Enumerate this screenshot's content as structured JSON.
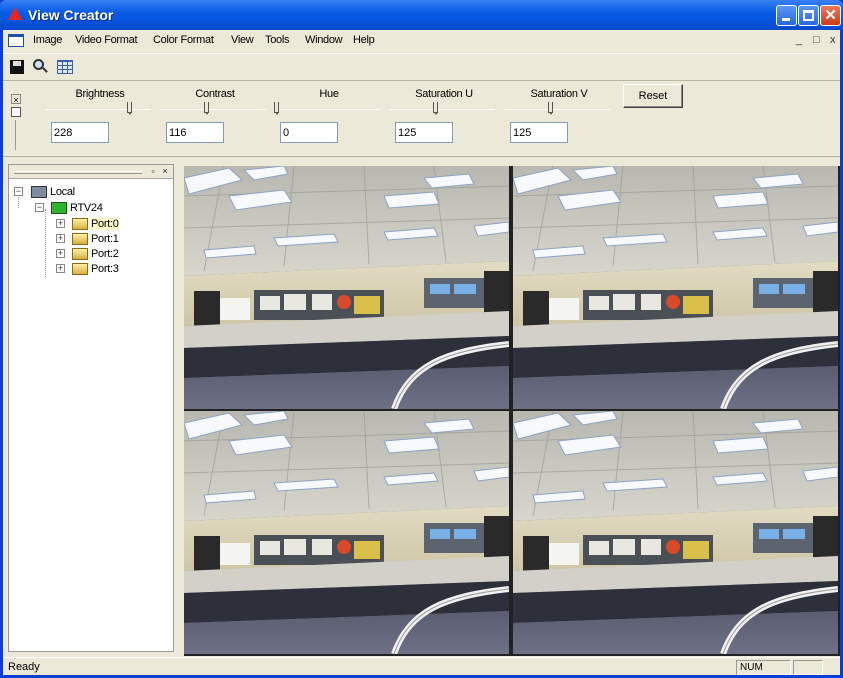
{
  "window": {
    "title": "View Creator"
  },
  "menu": [
    "Image",
    "Video Format",
    "Color Format",
    "View",
    "Tools",
    "Window",
    "Help"
  ],
  "mdi_buttons": {
    "minimize": "_",
    "restore": "□",
    "close": "x"
  },
  "toolbar": {
    "tools": [
      "save-icon",
      "zoom-icon",
      "grid-view-icon"
    ]
  },
  "controls": {
    "brightness": {
      "label": "Brightness",
      "value": "228"
    },
    "contrast": {
      "label": "Contrast",
      "value": "116"
    },
    "hue": {
      "label": "Hue",
      "value": "0"
    },
    "saturation_u": {
      "label": "Saturation U",
      "value": "125"
    },
    "saturation_v": {
      "label": "Saturation V",
      "value": "125"
    },
    "reset_label": "Reset"
  },
  "tree": {
    "root": "Local",
    "device": "RTV24",
    "ports": [
      "Port:0",
      "Port:1",
      "Port:2",
      "Port:3"
    ],
    "selected_port": 0
  },
  "video": {
    "feeds": 4,
    "layout": "2x2"
  },
  "status": {
    "text": "Ready",
    "num": "NUM"
  },
  "colors": {
    "titlebar": "#0a5ce6",
    "chrome": "#ece9d8",
    "close_button": "#c93d17",
    "tree_device": "#2fb32f"
  }
}
